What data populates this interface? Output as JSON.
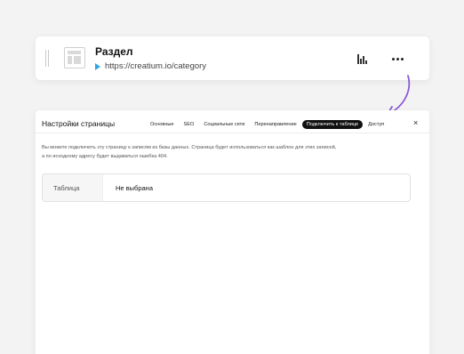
{
  "page_card": {
    "title": "Раздел",
    "url": "https://creatium.io/category",
    "icons": [
      "drag-handle-icon",
      "page-layout-icon",
      "play-icon",
      "stats-icon",
      "more-icon"
    ]
  },
  "panel": {
    "title": "Настройки страницы",
    "tabs": [
      {
        "label": "Основные",
        "active": false
      },
      {
        "label": "SEO",
        "active": false
      },
      {
        "label": "Социальные сети",
        "active": false
      },
      {
        "label": "Перенаправление",
        "active": false
      },
      {
        "label": "Подключить к таблице",
        "active": true
      },
      {
        "label": "Доступ",
        "active": false
      }
    ],
    "close_symbol": "×",
    "description_line1": "Вы можете подключить эту страницу к записям из базы данных. Страница будет использоваться как шаблон для этих записей,",
    "description_line2": "а по исходному адресу будет выдаваться ошибка 404.",
    "table_field": {
      "label": "Таблица",
      "value": "Не выбрана"
    }
  },
  "colors": {
    "accent_arrow": "#8b5ad8",
    "play": "#2fa8e0",
    "active_tab_bg": "#111111"
  }
}
